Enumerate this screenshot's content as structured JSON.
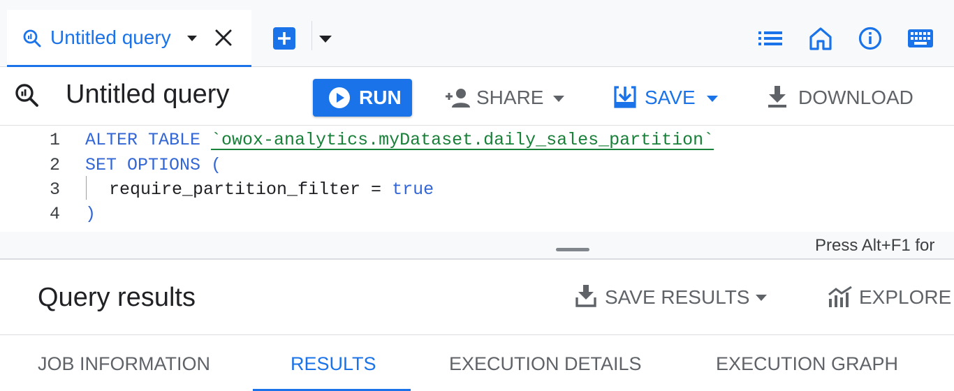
{
  "tabs": {
    "active_label": "Untitled query"
  },
  "toolbar": {
    "title": "Untitled query",
    "run_label": "RUN",
    "share_label": "SHARE",
    "save_label": "SAVE",
    "download_label": "DOWNLOAD"
  },
  "editor": {
    "line_numbers": [
      "1",
      "2",
      "3",
      "4"
    ],
    "lines": [
      {
        "kw": "ALTER TABLE ",
        "str": "`owox-analytics.myDataset.daily_sales_partition`"
      },
      {
        "kw": "SET OPTIONS ("
      },
      {
        "plain": "require_partition_filter = ",
        "kw": "true"
      },
      {
        "kw": ")"
      }
    ],
    "hint": "Press Alt+F1 for"
  },
  "results": {
    "title": "Query results",
    "save_results_label": "SAVE RESULTS",
    "explore_label": "EXPLORE D",
    "tabs": [
      "JOB INFORMATION",
      "RESULTS",
      "EXECUTION DETAILS",
      "EXECUTION GRAPH"
    ],
    "active_tab": "RESULTS"
  },
  "icons": {
    "tab_icon": "query-icon",
    "tab_caret": "caret-down-icon",
    "tab_close": "close-icon",
    "add_tab": "add-box-icon",
    "list": "list-icon",
    "home": "home-icon",
    "info": "info-icon",
    "keyboard": "keyboard-icon",
    "run": "play-circle-icon",
    "share": "person-add-icon",
    "save": "save-icon",
    "download": "download-icon",
    "save_results": "download-icon",
    "explore": "chart-icon"
  },
  "colors": {
    "accent": "#1a73e8",
    "keyword": "#3367d6",
    "string": "#188038",
    "muted": "#5f6368"
  }
}
